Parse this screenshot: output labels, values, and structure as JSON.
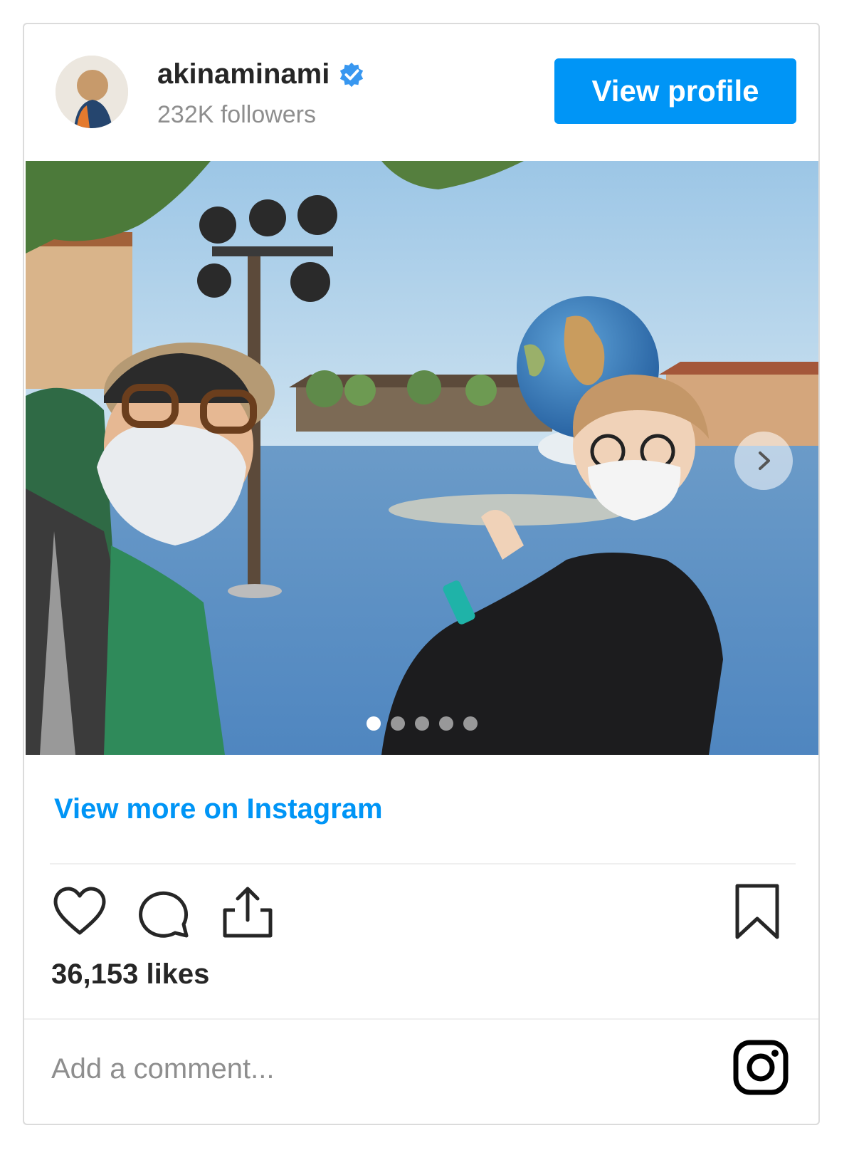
{
  "header": {
    "username": "akinaminami",
    "followers": "232K followers",
    "view_profile_label": "View profile"
  },
  "post": {
    "carousel_total": 5,
    "carousel_current": 1,
    "view_more_label": "View more on Instagram",
    "likes": "36,153 likes"
  },
  "comment": {
    "placeholder": "Add a comment..."
  },
  "colors": {
    "accent": "#0095f6",
    "text": "#262626",
    "muted": "#8e8e8e",
    "border": "#dbdbdb"
  },
  "icons": [
    "verified-badge-icon",
    "heart-icon",
    "comment-icon",
    "share-icon",
    "bookmark-icon",
    "instagram-logo-icon",
    "chevron-right-icon"
  ]
}
